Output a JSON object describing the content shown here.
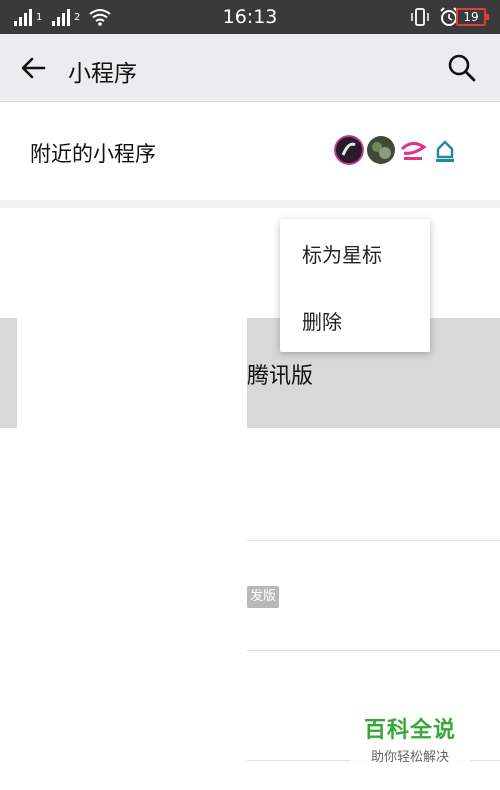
{
  "status_bar": {
    "time": "16:13",
    "sim1_label": "1",
    "sim2_label": "2",
    "battery": "19",
    "battery_color": "#e23b3b"
  },
  "header": {
    "title": "小程序",
    "back_icon": "arrow-left-icon",
    "search_icon": "search-icon"
  },
  "nearby": {
    "label": "附近的小程序",
    "logos": [
      "dark-circle-logo",
      "green-circle-logo",
      "pink-brand-logo",
      "blue-house-logo"
    ]
  },
  "list": {
    "row1_text": "腾讯版",
    "row2_badge": "发版"
  },
  "context_menu": {
    "items": [
      "标为星标",
      "删除"
    ]
  },
  "watermark": {
    "title": "百科全说",
    "subtitle": "助你轻松解决"
  }
}
